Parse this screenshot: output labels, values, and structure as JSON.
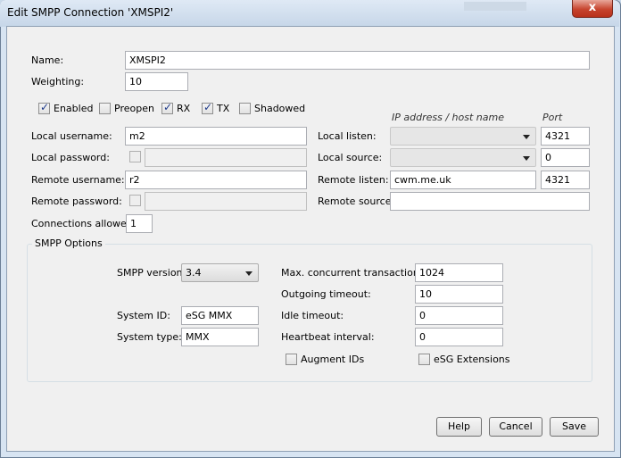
{
  "window": {
    "title": "Edit SMPP Connection 'XMSPI2'",
    "close_label": "x"
  },
  "form": {
    "name_label": "Name:",
    "name_value": "XMSPI2",
    "weighting_label": "Weighting:",
    "weighting_value": "10",
    "flags": [
      {
        "label": "Enabled",
        "checked": true
      },
      {
        "label": "Preopen",
        "checked": false
      },
      {
        "label": "RX",
        "checked": true
      },
      {
        "label": "TX",
        "checked": true
      },
      {
        "label": "Shadowed",
        "checked": false
      }
    ],
    "col_ip_header": "IP address / host name",
    "col_port_header": "Port",
    "local_username_label": "Local username:",
    "local_username_value": "m2",
    "local_password_label": "Local password:",
    "remote_username_label": "Remote username:",
    "remote_username_value": "r2",
    "remote_password_label": "Remote password:",
    "connections_allowed_label": "Connections allowed:",
    "connections_allowed_value": "1",
    "local_listen_label": "Local listen:",
    "local_listen_port": "4321",
    "local_source_label": "Local source:",
    "local_source_port": "0",
    "remote_listen_label": "Remote listen:",
    "remote_listen_host": "cwm.me.uk",
    "remote_listen_port": "4321",
    "remote_source_label": "Remote source:",
    "remote_source_host": ""
  },
  "smpp": {
    "group_title": "SMPP Options",
    "version_label": "SMPP version:",
    "version_value": "3.4",
    "system_id_label": "System ID:",
    "system_id_value": "eSG MMX",
    "system_type_label": "System type:",
    "system_type_value": "MMX",
    "max_concurrent_label": "Max. concurrent transactions:",
    "max_concurrent_value": "1024",
    "outgoing_timeout_label": "Outgoing timeout:",
    "outgoing_timeout_value": "10",
    "idle_timeout_label": "Idle timeout:",
    "idle_timeout_value": "0",
    "heartbeat_label": "Heartbeat interval:",
    "heartbeat_value": "0",
    "augment_ids_label": "Augment IDs",
    "esg_extensions_label": "eSG Extensions"
  },
  "buttons": {
    "help": "Help",
    "cancel": "Cancel",
    "save": "Save"
  }
}
